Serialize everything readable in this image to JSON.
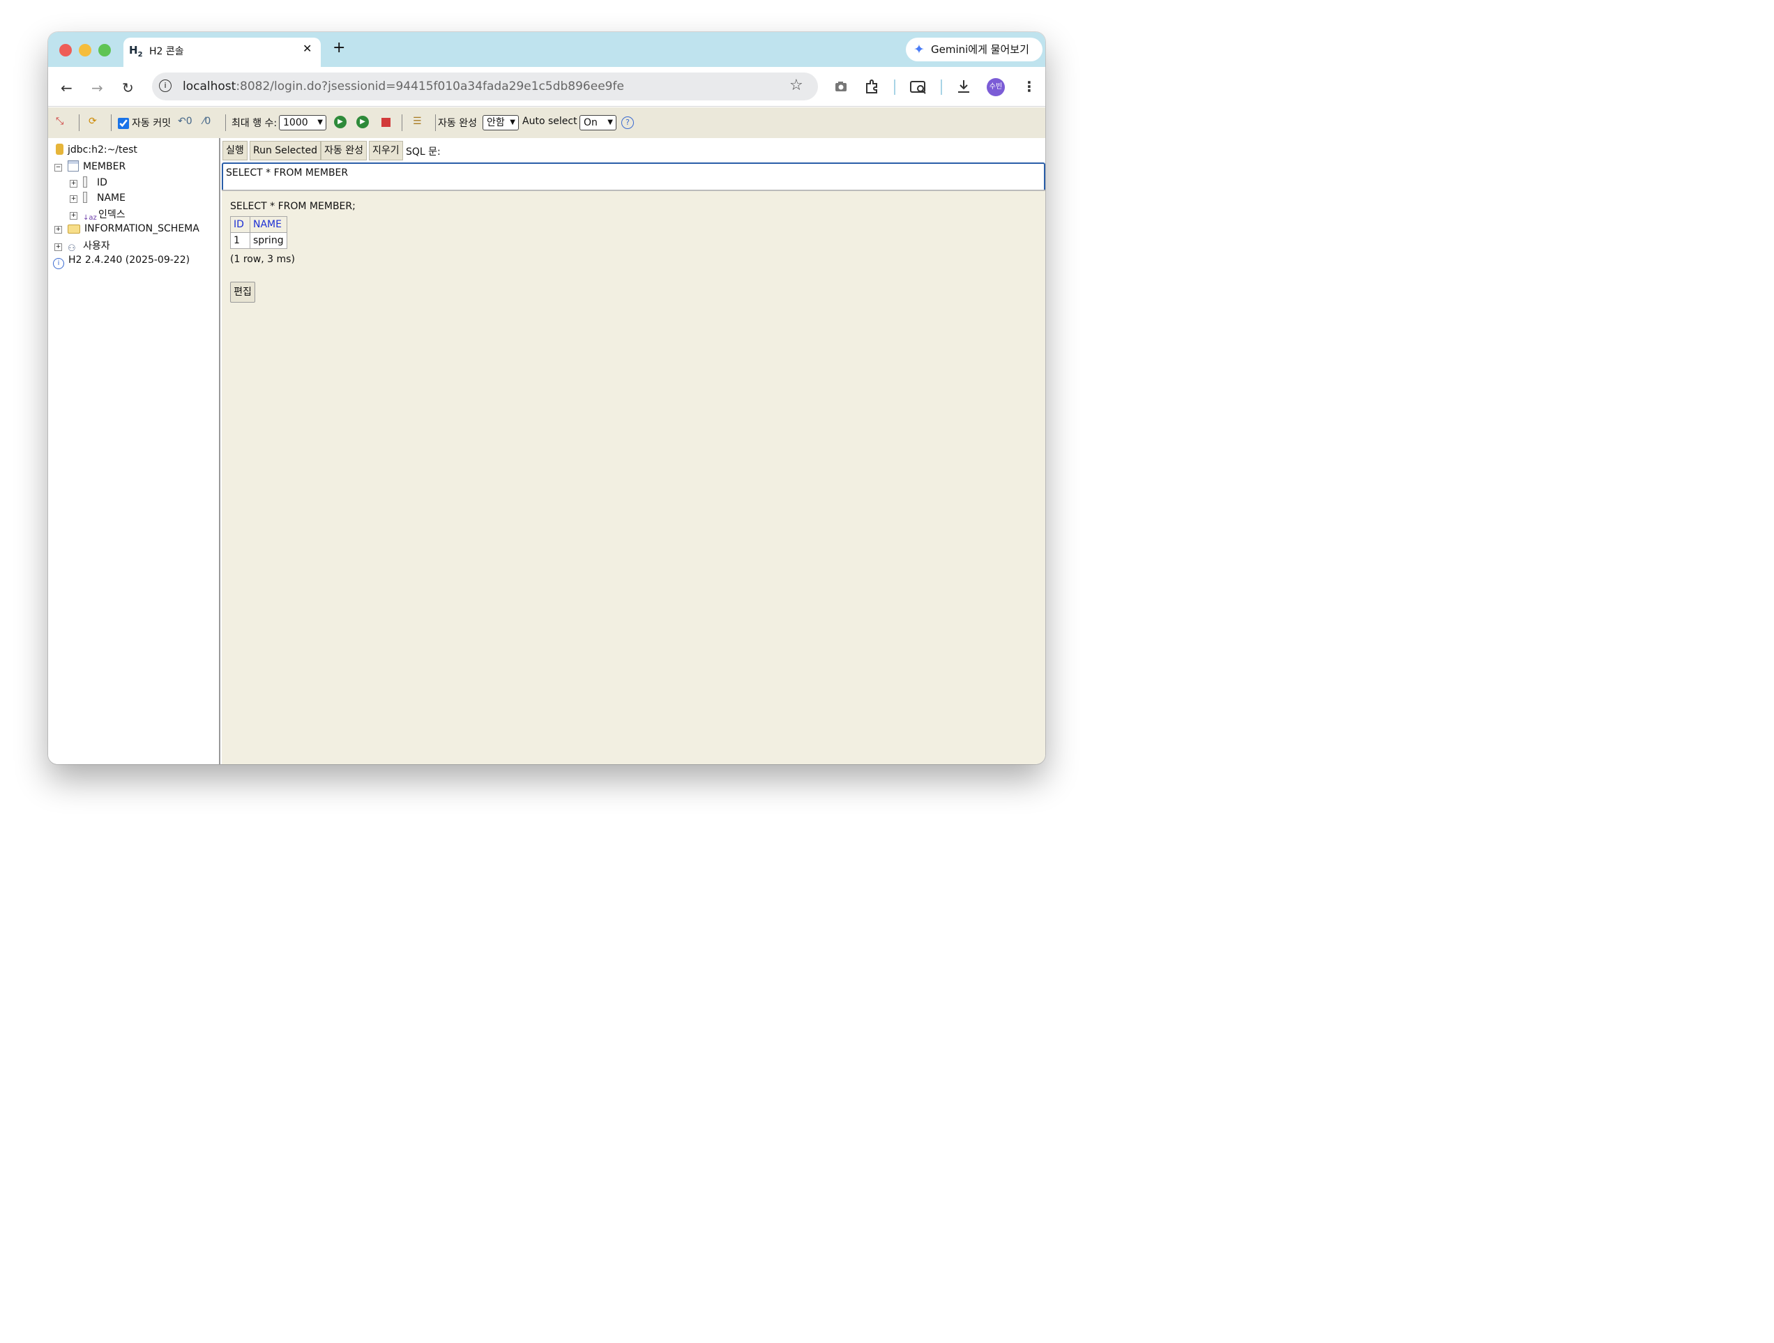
{
  "browser": {
    "tab_title": "H2 콘솔",
    "favicon": "H",
    "favicon_sub": "2",
    "gemini_label": "Gemini에게 물어보기",
    "url_host": "localhost",
    "url_rest": ":8082/login.do?jsessionid=94415f010a34fada29e1c5db896ee9fe",
    "avatar_label": "수빈"
  },
  "toolbar": {
    "autocommit_label": "자동 커밋",
    "maxrows_label": "최대 행 수:",
    "maxrows_value": "1000",
    "autocomplete_label": "자동 완성",
    "autocomplete_value": "안함",
    "autoselect_label": "Auto select",
    "autoselect_value": "On"
  },
  "tree": {
    "connection": "jdbc:h2:~/test",
    "table": "MEMBER",
    "columns": [
      "ID",
      "NAME"
    ],
    "index_label": "인덱스",
    "schema": "INFORMATION_SCHEMA",
    "users": "사용자",
    "version": "H2 2.4.240 (2025-09-22)"
  },
  "sql": {
    "run_label": "실행",
    "run_selected_label": "Run Selected",
    "autocomplete_btn_label": "자동 완성",
    "clear_label": "지우기",
    "statement_label": "SQL 문:",
    "text": "SELECT * FROM MEMBER"
  },
  "result": {
    "query": "SELECT * FROM MEMBER;",
    "headers": [
      "ID",
      "NAME"
    ],
    "rows": [
      [
        "1",
        "spring"
      ]
    ],
    "summary": "(1 row, 3 ms)",
    "edit_label": "편집"
  }
}
